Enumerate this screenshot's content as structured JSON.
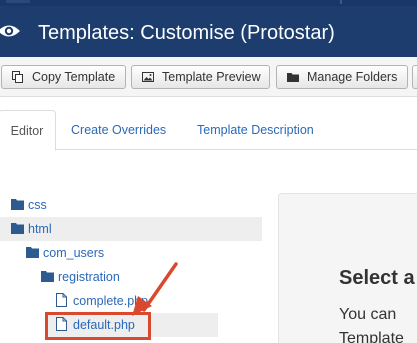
{
  "header": {
    "title": "Templates: Customise (Protostar)",
    "icon": "eye-icon"
  },
  "toolbar": {
    "buttons": [
      {
        "label": "Copy Template",
        "icon": "copy-icon"
      },
      {
        "label": "Template Preview",
        "icon": "image-icon"
      },
      {
        "label": "Manage Folders",
        "icon": "folder-icon"
      }
    ]
  },
  "tabs": [
    {
      "label": "Editor",
      "active": true
    },
    {
      "label": "Create Overrides",
      "active": false
    },
    {
      "label": "Template Description",
      "active": false
    }
  ],
  "tree": {
    "items": [
      {
        "label": "css",
        "type": "folder"
      },
      {
        "label": "html",
        "type": "folder"
      },
      {
        "label": "com_users",
        "type": "folder"
      },
      {
        "label": "registration",
        "type": "folder"
      },
      {
        "label": "complete.php",
        "type": "file"
      },
      {
        "label": "default.php",
        "type": "file",
        "highlighted": true
      }
    ]
  },
  "panel": {
    "title": "Select a",
    "text_line1": "You can",
    "text_line2": "Template"
  },
  "colors": {
    "header_bg": "#1c3d6e",
    "link": "#2a69b8",
    "highlight": "#d9492e"
  }
}
